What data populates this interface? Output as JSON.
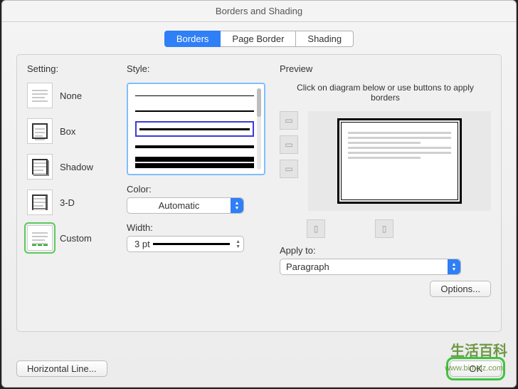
{
  "window": {
    "title": "Borders and Shading"
  },
  "tabs": {
    "borders": "Borders",
    "page_border": "Page Border",
    "shading": "Shading",
    "active": "borders"
  },
  "setting": {
    "label": "Setting:",
    "items": [
      {
        "key": "none",
        "label": "None"
      },
      {
        "key": "box",
        "label": "Box"
      },
      {
        "key": "shadow",
        "label": "Shadow"
      },
      {
        "key": "3d",
        "label": "3-D"
      },
      {
        "key": "custom",
        "label": "Custom"
      }
    ],
    "selected": "custom"
  },
  "style": {
    "label": "Style:",
    "color_label": "Color:",
    "color_value": "Automatic",
    "width_label": "Width:",
    "width_value": "3 pt"
  },
  "preview": {
    "label": "Preview",
    "hint": "Click on diagram below or use buttons to apply borders",
    "apply_label": "Apply to:",
    "apply_value": "Paragraph",
    "options_label": "Options..."
  },
  "footer": {
    "horizontal_line": "Horizontal Line...",
    "ok": "OK"
  },
  "watermark": {
    "brand": "生活百科",
    "url": "www.bimeiz.com"
  }
}
